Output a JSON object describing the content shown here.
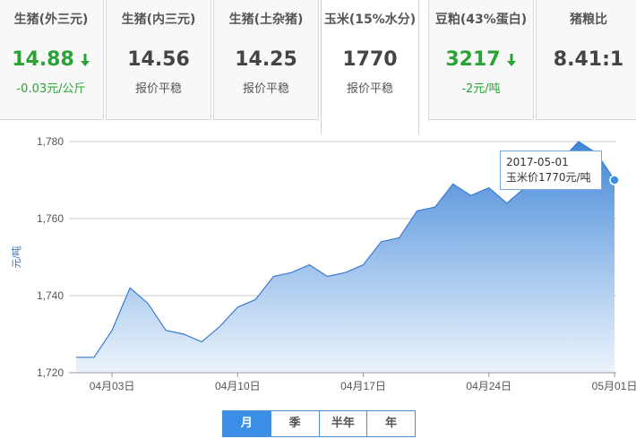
{
  "tiles": [
    {
      "name": "生猪(外三元)",
      "value": "14.88",
      "trend": "down",
      "sub": "-0.03元/公斤"
    },
    {
      "name": "生猪(内三元)",
      "value": "14.56",
      "trend": "",
      "sub": "报价平稳"
    },
    {
      "name": "生猪(土杂猪)",
      "value": "14.25",
      "trend": "",
      "sub": "报价平稳"
    },
    {
      "name": "玉米(15%水分)",
      "value": "1770",
      "trend": "",
      "sub": "报价平稳"
    },
    {
      "name": "豆粕(43%蛋白)",
      "value": "3217",
      "trend": "down",
      "sub": "-2元/吨"
    },
    {
      "name": "猪粮比",
      "value": "8.41:1",
      "trend": "",
      "sub": ""
    }
  ],
  "colors": {
    "accent": "#3a8ee6",
    "down": "#2aa236",
    "area": "#4a8bd8"
  },
  "chart_data": {
    "type": "area",
    "ylabel": "元/吨",
    "ylim": [
      1720,
      1780
    ],
    "yticks": [
      "1,720",
      "1,740",
      "1,760",
      "1,780"
    ],
    "xtick_labels": [
      {
        "label": "04月03日",
        "date": "2017-04-03"
      },
      {
        "label": "04月10日",
        "date": "2017-04-10"
      },
      {
        "label": "04月17日",
        "date": "2017-04-17"
      },
      {
        "label": "04月24日",
        "date": "2017-04-24"
      },
      {
        "label": "05月01日",
        "date": "2017-05-01"
      }
    ],
    "x": [
      "2017-04-01",
      "2017-04-02",
      "2017-04-03",
      "2017-04-04",
      "2017-04-05",
      "2017-04-06",
      "2017-04-07",
      "2017-04-08",
      "2017-04-09",
      "2017-04-10",
      "2017-04-11",
      "2017-04-12",
      "2017-04-13",
      "2017-04-14",
      "2017-04-15",
      "2017-04-16",
      "2017-04-17",
      "2017-04-18",
      "2017-04-19",
      "2017-04-20",
      "2017-04-21",
      "2017-04-22",
      "2017-04-23",
      "2017-04-24",
      "2017-04-25",
      "2017-04-26",
      "2017-04-27",
      "2017-04-28",
      "2017-04-29",
      "2017-04-30",
      "2017-05-01"
    ],
    "values": [
      1724,
      1724,
      1731,
      1742,
      1738,
      1731,
      1730,
      1728,
      1732,
      1737,
      1739,
      1745,
      1746,
      1748,
      1745,
      1746,
      1748,
      1754,
      1755,
      1762,
      1763,
      1769,
      1766,
      1768,
      1764,
      1768,
      1770,
      1775,
      1780,
      1777,
      1770
    ],
    "tooltip": {
      "date": "2017-05-01",
      "text": "玉米价1770元/吨"
    },
    "grid": true
  },
  "tabs": [
    {
      "label": "月",
      "active": true
    },
    {
      "label": "季",
      "active": false
    },
    {
      "label": "半年",
      "active": false
    },
    {
      "label": "年",
      "active": false
    }
  ]
}
